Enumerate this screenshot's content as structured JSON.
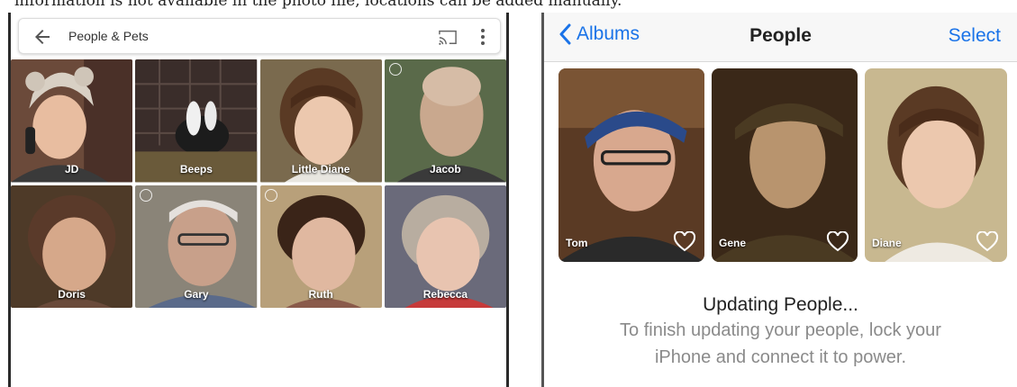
{
  "caption": "information is not available in the photo file, locations can be added manually.",
  "google_photos": {
    "header": {
      "title": "People & Pets",
      "back_icon": "arrow-back-icon",
      "cast_icon": "cast-icon",
      "more_icon": "more-vert-icon"
    },
    "people": [
      {
        "name": "JD"
      },
      {
        "name": "Beeps"
      },
      {
        "name": "Little Diane"
      },
      {
        "name": "Jacob"
      },
      {
        "name": "Doris"
      },
      {
        "name": "Gary"
      },
      {
        "name": "Ruth"
      },
      {
        "name": "Rebecca"
      }
    ]
  },
  "ios_photos": {
    "nav": {
      "back_label": "Albums",
      "title": "People",
      "select_label": "Select"
    },
    "people": [
      {
        "name": "Tom"
      },
      {
        "name": "Gene"
      },
      {
        "name": "Diane"
      }
    ],
    "status": {
      "title": "Updating People...",
      "line1": "To finish updating your people, lock your",
      "line2": "iPhone and connect it to power."
    },
    "accent_color": "#1a73e8"
  }
}
